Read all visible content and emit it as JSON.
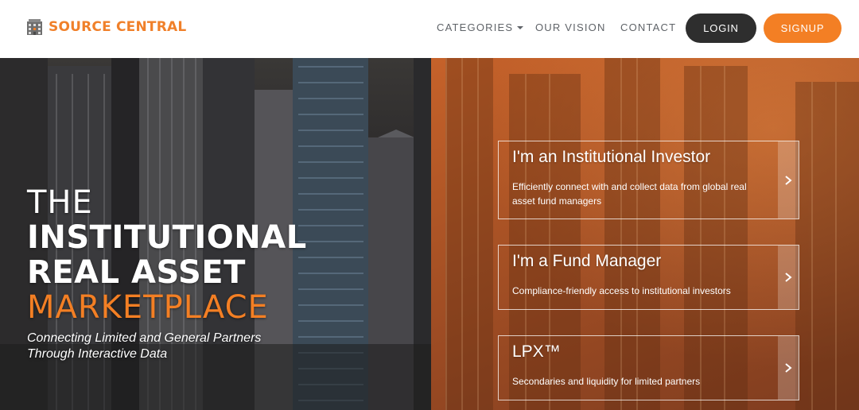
{
  "brand": {
    "name": "SOURCE CENTRAL",
    "icon": "building-grid-icon",
    "color": "#f0802a"
  },
  "nav": {
    "categories": "CATEGORIES",
    "vision": "OUR VISION",
    "contact": "CONTACT",
    "login": "LOGIN",
    "signup": "SIGNUP"
  },
  "hero": {
    "line1": "THE",
    "line2": "INSTITUTIONAL",
    "line3": "REAL ASSET",
    "line4": "MARKETPLACE",
    "tagline": "Connecting Limited and General Partners Through Interactive Data"
  },
  "cards": [
    {
      "title": "I'm an Institutional Investor",
      "desc": "Efficiently connect with and collect data from global real asset fund managers",
      "icon": "chevron-right-icon"
    },
    {
      "title": "I'm a Fund Manager",
      "desc": "Compliance-friendly access to institutional investors",
      "icon": "chevron-right-icon"
    },
    {
      "title": "LPX™",
      "desc": "Secondaries and liquidity for limited partners",
      "icon": "chevron-right-icon"
    }
  ],
  "colors": {
    "accent": "#f37f24",
    "login_bg": "#2e2e2e",
    "nav_text": "#5f6368"
  }
}
